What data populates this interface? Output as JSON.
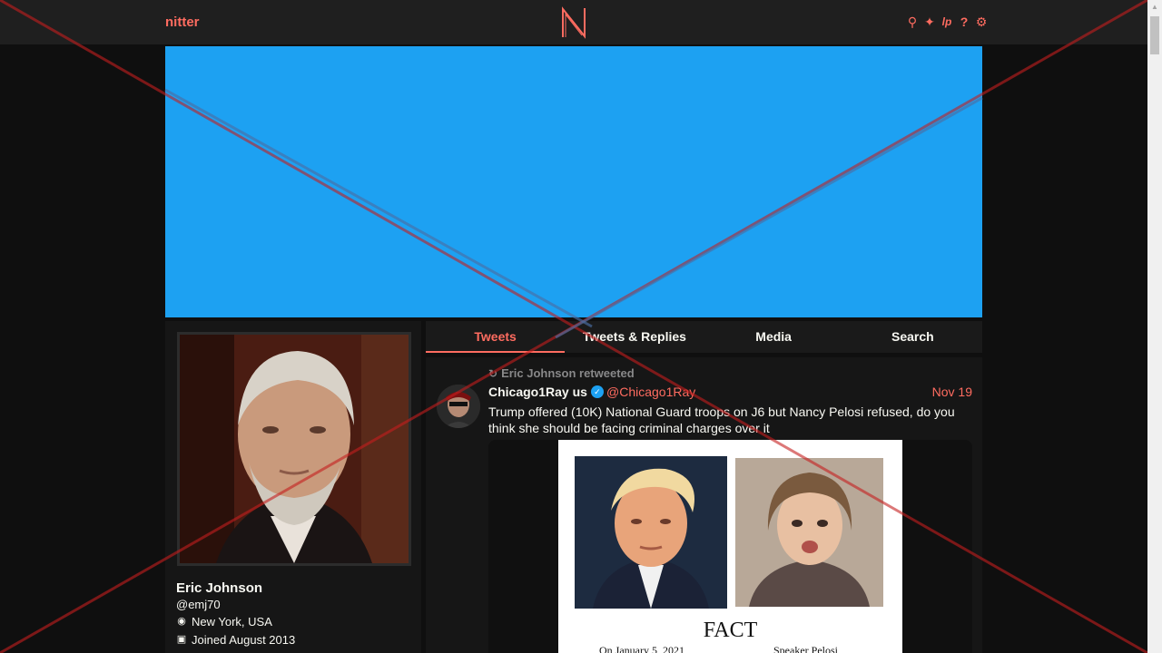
{
  "navbar": {
    "brand": "nitter",
    "icons": [
      "search-icon",
      "twitter-icon",
      "rss-icon",
      "help-icon",
      "settings-icon"
    ]
  },
  "banner": {
    "color": "#1da1f2"
  },
  "profile": {
    "fullname": "Eric Johnson",
    "username": "@emj70",
    "location": "New York, USA",
    "joined": "Joined August 2013"
  },
  "tabs": [
    {
      "label": "Tweets",
      "active": true
    },
    {
      "label": "Tweets & Replies",
      "active": false
    },
    {
      "label": "Media",
      "active": false
    },
    {
      "label": "Search",
      "active": false
    }
  ],
  "tweet": {
    "retweet_header": "Eric Johnson retweeted",
    "fullname": "Chicago1Ray us",
    "username": "@Chicago1Ray",
    "date": "Nov 19",
    "text": "Trump offered (10K) National Guard troops on J6 but Nancy Pelosi refused, do you think she should be facing criminal charges over it",
    "media": {
      "caption": "FACT",
      "sub_left": "On January 5, 2021",
      "sub_right": "Speaker Pelosi"
    }
  },
  "colors": {
    "accent": "#ff6c60",
    "background": "#0f0f0f",
    "panel": "#161616",
    "text": "#f8f8f2",
    "muted": "#888889",
    "banner": "#1da1f2",
    "overlay_red": "#c41e1e",
    "overlay_blue": "#4a6fa5"
  }
}
